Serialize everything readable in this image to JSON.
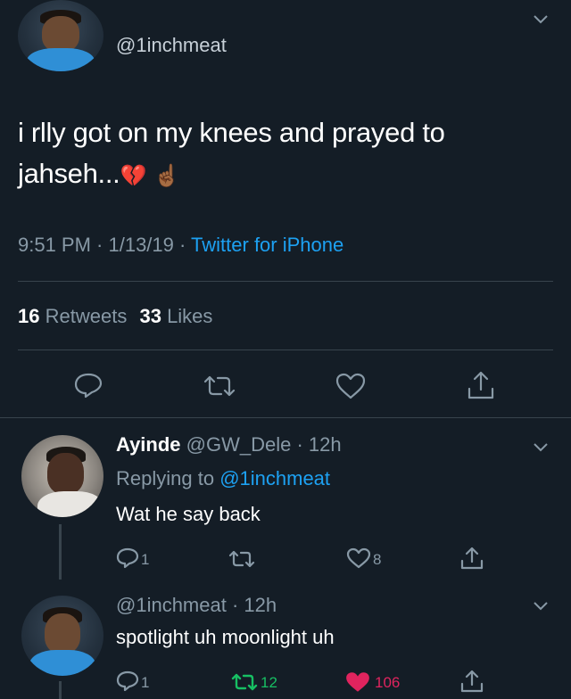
{
  "main_tweet": {
    "handle": "@1inchmeat",
    "text_line1": "i rlly got on my knees and prayed to",
    "text_line2": "jahseh...",
    "emoji1": "💔",
    "emoji2": "☝🏾",
    "time": "9:51 PM · 1/13/19 · ",
    "source": "Twitter for iPhone",
    "retweets_count": "16",
    "retweets_label": "Retweets",
    "likes_count": "33",
    "likes_label": "Likes"
  },
  "reply1": {
    "name": "Ayinde",
    "meta": "@GW_Dele · 12h",
    "replying_prefix": "Replying to ",
    "replying_handle": "@1inchmeat",
    "text": "Wat he say back",
    "reply_count": "1",
    "retweet_count": "",
    "like_count": "8"
  },
  "reply2": {
    "meta": "@1inchmeat · 12h",
    "text": "spotlight uh moonlight uh",
    "reply_count": "1",
    "retweet_count": "12",
    "like_count": "106"
  },
  "colors": {
    "background": "#141d26",
    "muted": "#8899a6",
    "link": "#1da1f2",
    "retweeted": "#17bf63",
    "liked": "#e0245e"
  }
}
